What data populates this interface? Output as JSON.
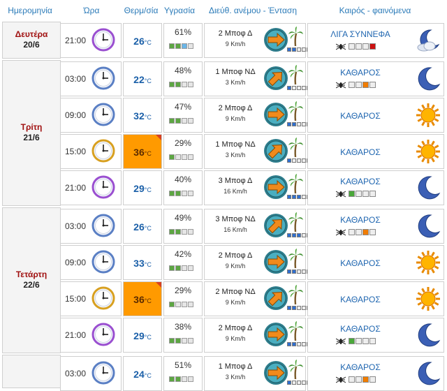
{
  "headers": {
    "date": "Ημερομηνία",
    "time": "Ώρα",
    "temp": "Θερμ/σία",
    "humidity": "Υγρασία",
    "wind": "Διεύθ. ανέμου - Ένταση",
    "weather": "Καιρός - φαινόμενα"
  },
  "temp_unit": "°C",
  "humidity_unit": "%",
  "colors": {
    "link_blue": "#2a7ab8",
    "hot": "#ff9a00",
    "day_red": "#a01010"
  },
  "days": [
    {
      "name": "Δευτέρα",
      "date": "20/6"
    },
    {
      "name": "Τρίτη",
      "date": "21/6"
    },
    {
      "name": "Τετάρτη",
      "date": "22/6"
    }
  ],
  "rows": [
    {
      "time": "21:00",
      "temp": "26",
      "hot": false,
      "humidity": "61",
      "hum_level": 3,
      "wind_dir": "2 Μποφ Δ",
      "wind_speed": "9 Km/h",
      "wind_level": 2,
      "condition": "ΛΙΓΑ ΣΥΝΝΕΦΑ",
      "mosquito": true,
      "mosq_level": 4,
      "mosq_color": "#cc1111",
      "icon": "cloudy-moon-icon",
      "arrow": "arrow-east",
      "clock_color": "#9a4fd0"
    },
    {
      "time": "03:00",
      "temp": "22",
      "hot": false,
      "humidity": "48",
      "hum_level": 2,
      "wind_dir": "1 Μποφ ΝΔ",
      "wind_speed": "3 Km/h",
      "wind_level": 1,
      "condition": "ΚΑΘΑΡΟΣ",
      "mosquito": true,
      "mosq_level": 3,
      "mosq_color": "#f07c00",
      "icon": "moon-icon",
      "arrow": "arrow-northeast",
      "clock_color": "#5a7fc4"
    },
    {
      "time": "09:00",
      "temp": "32",
      "hot": false,
      "humidity": "47",
      "hum_level": 2,
      "wind_dir": "2 Μποφ Δ",
      "wind_speed": "9 Km/h",
      "wind_level": 2,
      "condition": "ΚΑΘΑΡΟΣ",
      "mosquito": false,
      "mosq_level": 0,
      "mosq_color": "#eee",
      "icon": "sun-icon",
      "arrow": "arrow-east",
      "clock_color": "#5a7fc4"
    },
    {
      "time": "15:00",
      "temp": "36",
      "hot": true,
      "humidity": "29",
      "hum_level": 1,
      "wind_dir": "1 Μποφ ΝΔ",
      "wind_speed": "3 Km/h",
      "wind_level": 1,
      "condition": "ΚΑΘΑΡΟΣ",
      "mosquito": false,
      "mosq_level": 0,
      "mosq_color": "#eee",
      "icon": "sun-icon",
      "arrow": "arrow-northeast",
      "clock_color": "#d8a020"
    },
    {
      "time": "21:00",
      "temp": "29",
      "hot": false,
      "humidity": "40",
      "hum_level": 2,
      "wind_dir": "3 Μποφ Δ",
      "wind_speed": "16 Km/h",
      "wind_level": 3,
      "condition": "ΚΑΘΑΡΟΣ",
      "mosquito": true,
      "mosq_level": 1,
      "mosq_color": "#4aa83a",
      "icon": "moon-icon",
      "arrow": "arrow-east",
      "clock_color": "#9a4fd0"
    },
    {
      "time": "03:00",
      "temp": "26",
      "hot": false,
      "humidity": "49",
      "hum_level": 2,
      "wind_dir": "3 Μποφ ΝΔ",
      "wind_speed": "16 Km/h",
      "wind_level": 3,
      "condition": "ΚΑΘΑΡΟΣ",
      "mosquito": true,
      "mosq_level": 3,
      "mosq_color": "#f07c00",
      "icon": "moon-icon",
      "arrow": "arrow-northeast",
      "clock_color": "#5a7fc4"
    },
    {
      "time": "09:00",
      "temp": "33",
      "hot": false,
      "humidity": "42",
      "hum_level": 2,
      "wind_dir": "2 Μποφ Δ",
      "wind_speed": "9 Km/h",
      "wind_level": 2,
      "condition": "ΚΑΘΑΡΟΣ",
      "mosquito": false,
      "mosq_level": 0,
      "mosq_color": "#eee",
      "icon": "sun-icon",
      "arrow": "arrow-east",
      "clock_color": "#5a7fc4"
    },
    {
      "time": "15:00",
      "temp": "36",
      "hot": true,
      "humidity": "29",
      "hum_level": 1,
      "wind_dir": "2 Μποφ ΝΔ",
      "wind_speed": "9 Km/h",
      "wind_level": 2,
      "condition": "ΚΑΘΑΡΟΣ",
      "mosquito": false,
      "mosq_level": 0,
      "mosq_color": "#eee",
      "icon": "sun-icon",
      "arrow": "arrow-northeast",
      "clock_color": "#d8a020"
    },
    {
      "time": "21:00",
      "temp": "29",
      "hot": false,
      "humidity": "38",
      "hum_level": 2,
      "wind_dir": "2 Μποφ Δ",
      "wind_speed": "9 Km/h",
      "wind_level": 2,
      "condition": "ΚΑΘΑΡΟΣ",
      "mosquito": true,
      "mosq_level": 1,
      "mosq_color": "#4aa83a",
      "icon": "moon-icon",
      "arrow": "arrow-east",
      "clock_color": "#9a4fd0"
    },
    {
      "time": "03:00",
      "temp": "24",
      "hot": false,
      "humidity": "51",
      "hum_level": 2,
      "wind_dir": "1 Μποφ Δ",
      "wind_speed": "3 Km/h",
      "wind_level": 1,
      "condition": "ΚΑΘΑΡΟΣ",
      "mosquito": true,
      "mosq_level": 3,
      "mosq_color": "#f07c00",
      "icon": "moon-icon",
      "arrow": "arrow-east",
      "clock_color": "#5a7fc4"
    }
  ]
}
